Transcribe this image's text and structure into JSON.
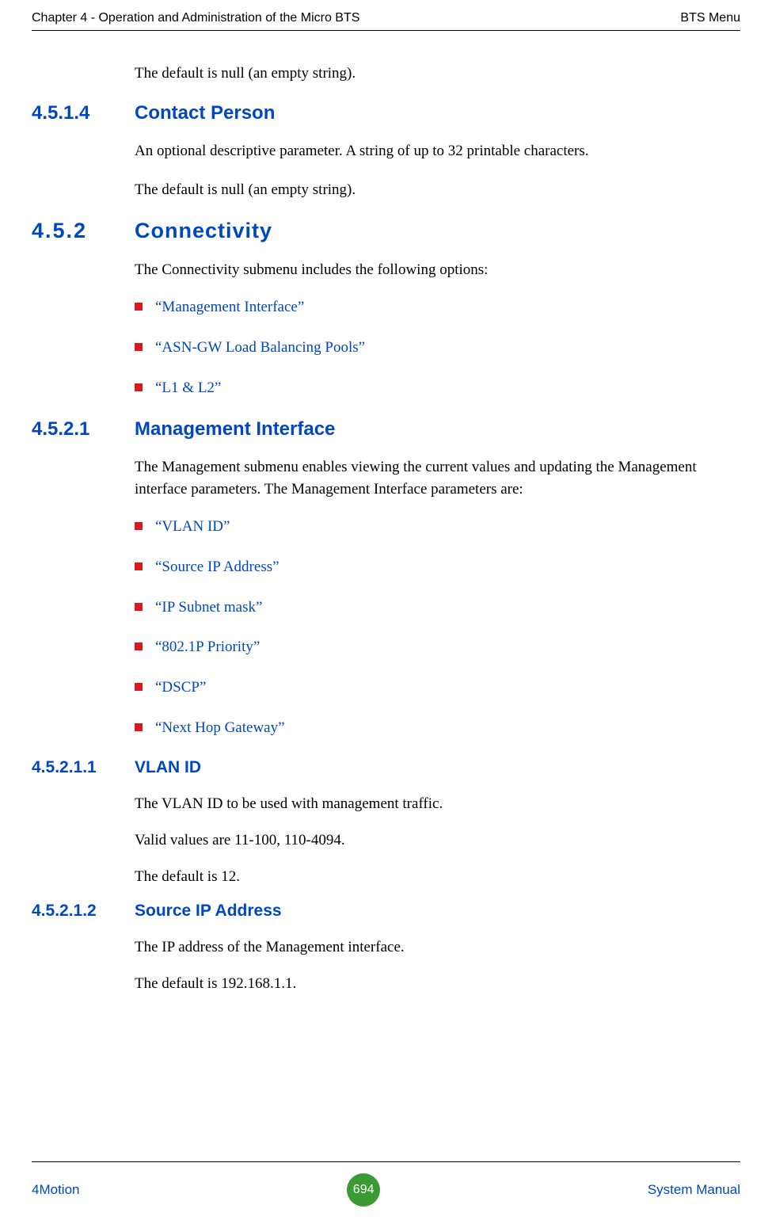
{
  "header": {
    "left": "Chapter 4 - Operation and Administration of the Micro BTS",
    "right": "BTS Menu"
  },
  "intro_text": "The default is null (an empty string).",
  "s45_1_4": {
    "num": "4.5.1.4",
    "title": "Contact Person",
    "p1": "An optional descriptive parameter. A string of up to 32 printable characters.",
    "p2": "The default is null (an empty string)."
  },
  "s45_2": {
    "num": "4.5.2",
    "title": "Connectivity",
    "p1": "The Connectivity submenu includes the following options:",
    "bullets": {
      "0": "“Management Interface”",
      "1": "“ASN-GW Load Balancing Pools”",
      "2": "“L1 & L2”"
    }
  },
  "s45_2_1": {
    "num": "4.5.2.1",
    "title": "Management Interface",
    "p1": "The Management submenu enables viewing the current values and updating the Management interface parameters. The Management Interface parameters are:",
    "bullets": {
      "0": "“VLAN ID”",
      "1": "“Source IP Address”",
      "2": "“IP Subnet mask”",
      "3": "“802.1P Priority”",
      "4": "“DSCP”",
      "5": "“Next Hop Gateway”"
    }
  },
  "s45_2_1_1": {
    "num": "4.5.2.1.1",
    "title": "VLAN ID",
    "p1": "The VLAN ID to be used with management traffic.",
    "p2": "Valid values are 11-100, 110-4094.",
    "p3": "The default is 12."
  },
  "s45_2_1_2": {
    "num": "4.5.2.1.2",
    "title": "Source IP Address",
    "p1": "The IP address of the Management interface.",
    "p2": "The default is 192.168.1.1."
  },
  "footer": {
    "left": "4Motion",
    "page": "694",
    "right": "System Manual"
  }
}
